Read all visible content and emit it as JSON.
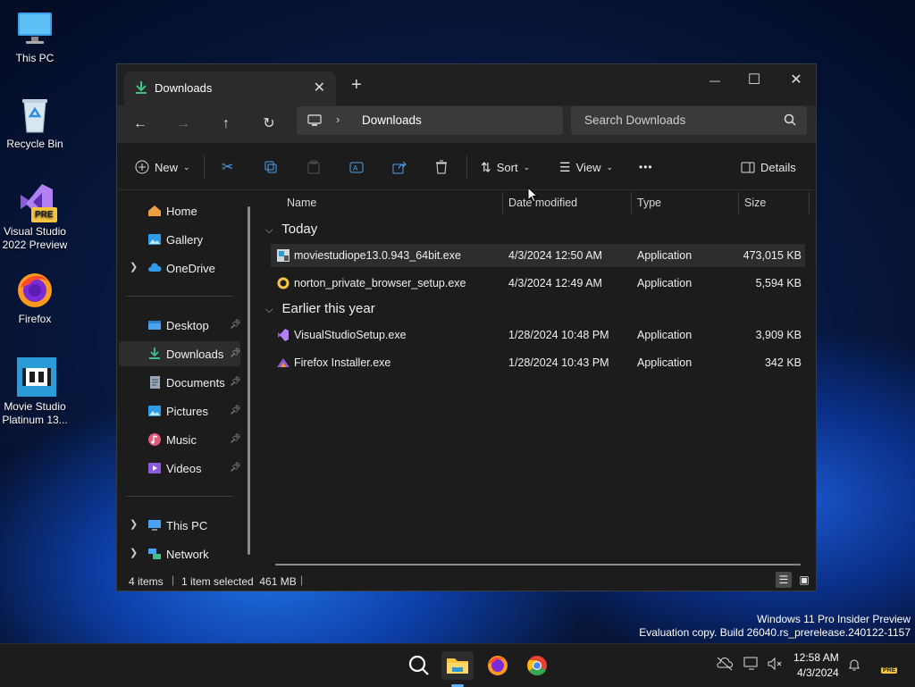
{
  "desktop": {
    "icons": [
      {
        "label": "This PC",
        "icon": "monitor-icon"
      },
      {
        "label": "Recycle Bin",
        "icon": "recycle-bin-icon"
      },
      {
        "label": "Visual Studio 2022 Preview",
        "icon": "visual-studio-icon",
        "badge": "PRE"
      },
      {
        "label": "Firefox",
        "icon": "firefox-icon"
      },
      {
        "label": "Movie Studio Platinum 13...",
        "icon": "movie-studio-icon"
      }
    ]
  },
  "window": {
    "tab_title": "Downloads",
    "new_tab": "+",
    "controls": {
      "minimize": "—",
      "maximize": "☐",
      "close": "✕"
    },
    "address": {
      "segment": "Downloads"
    },
    "search_placeholder": "Search Downloads",
    "commands": {
      "new": "New",
      "sort": "Sort",
      "view": "View",
      "more": "•••",
      "details": "Details"
    }
  },
  "nav": {
    "quick": [
      {
        "label": "Home",
        "icon": "home-icon"
      },
      {
        "label": "Gallery",
        "icon": "gallery-icon"
      },
      {
        "label": "OneDrive",
        "icon": "cloud-icon",
        "expandable": true
      }
    ],
    "pinned": [
      {
        "label": "Desktop",
        "icon": "desktop-folder-icon"
      },
      {
        "label": "Downloads",
        "icon": "download-icon",
        "selected": true
      },
      {
        "label": "Documents",
        "icon": "documents-icon"
      },
      {
        "label": "Pictures",
        "icon": "pictures-icon"
      },
      {
        "label": "Music",
        "icon": "music-icon"
      },
      {
        "label": "Videos",
        "icon": "videos-icon"
      }
    ],
    "drives": [
      {
        "label": "This PC",
        "icon": "monitor-icon"
      },
      {
        "label": "Network",
        "icon": "network-icon"
      }
    ]
  },
  "files": {
    "columns": [
      "Name",
      "Date modified",
      "Type",
      "Size"
    ],
    "groups": [
      {
        "label": "Today",
        "rows": [
          {
            "name": "moviestudiope13.0.943_64bit.exe",
            "date": "4/3/2024 12:50 AM",
            "type": "Application",
            "size": "473,015 KB",
            "selected": true,
            "icon": "installer-icon"
          },
          {
            "name": "norton_private_browser_setup.exe",
            "date": "4/3/2024 12:49 AM",
            "type": "Application",
            "size": "5,594 KB",
            "icon": "norton-icon"
          }
        ]
      },
      {
        "label": "Earlier this year",
        "rows": [
          {
            "name": "VisualStudioSetup.exe",
            "date": "1/28/2024 10:48 PM",
            "type": "Application",
            "size": "3,909 KB",
            "icon": "visual-studio-icon"
          },
          {
            "name": "Firefox Installer.exe",
            "date": "1/28/2024 10:43 PM",
            "type": "Application",
            "size": "342 KB",
            "icon": "firefox-icon"
          }
        ]
      }
    ]
  },
  "status": {
    "items": "4 items",
    "selection": "1 item selected  461 MB"
  },
  "watermark": {
    "line1": "Windows 11 Pro Insider Preview",
    "line2": "Evaluation copy. Build 26040.rs_prerelease.240122-1157"
  },
  "taskbar": {
    "time": "12:58 AM",
    "date": "4/3/2024",
    "tray_badge": "PRE"
  }
}
